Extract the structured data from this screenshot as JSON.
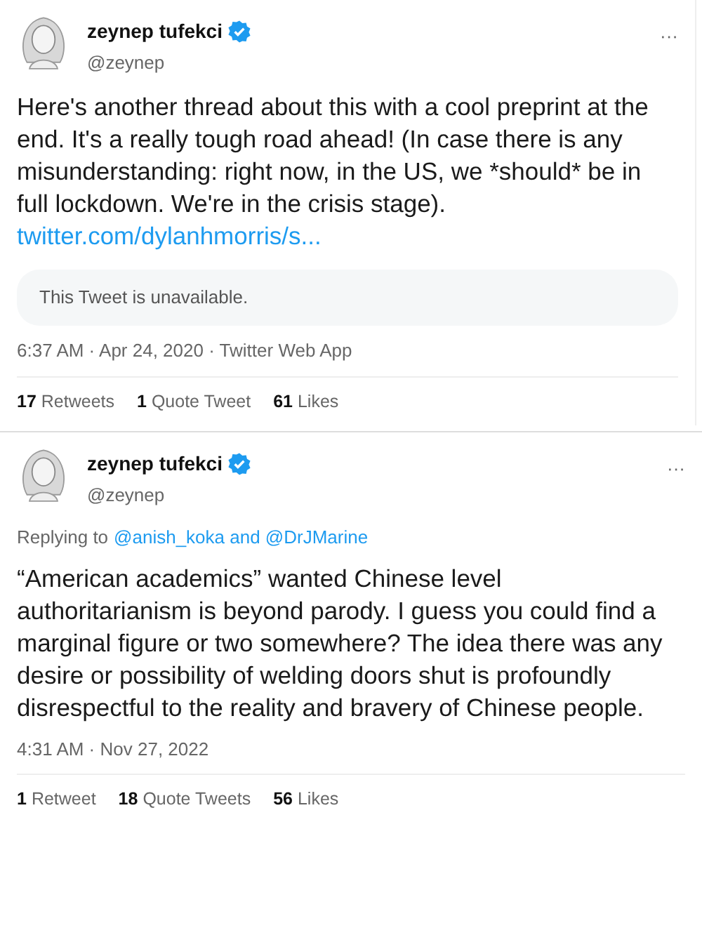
{
  "tweets": [
    {
      "author": {
        "name": "zeynep tufekci",
        "verified": true,
        "handle": "@zeynep"
      },
      "more": "···",
      "text": "Here's another thread about this with a cool preprint at the end. It's a really tough road ahead! (In case there is any misunderstanding: right now, in the US, we *should* be in full lockdown. We're in the crisis stage).",
      "link": "twitter.com/dylanhmorris/s...",
      "quote": "This Tweet is unavailable.",
      "meta": "6:37 AM · Apr 24, 2020 · Twitter Web App",
      "stats": [
        {
          "count": "17",
          "label": "Retweets"
        },
        {
          "count": "1",
          "label": "Quote Tweet"
        },
        {
          "count": "61",
          "label": "Likes"
        }
      ]
    },
    {
      "author": {
        "name": "zeynep tufekci",
        "verified": true,
        "handle": "@zeynep"
      },
      "more": "···",
      "replying_to": {
        "prefix": "Replying to",
        "mentions": "@anish_koka and @DrJMarine"
      },
      "text": "“American academics” wanted Chinese level authoritarianism is beyond parody. I guess you could find a marginal figure or two somewhere? The idea there was any desire or possibility of welding doors shut is profoundly disrespectful to the reality and bravery of Chinese people.",
      "meta": "4:31 AM · Nov 27, 2022",
      "stats": [
        {
          "count": "1",
          "label": "Retweet"
        },
        {
          "count": "18",
          "label": "Quote Tweets"
        },
        {
          "count": "56",
          "label": "Likes"
        }
      ]
    }
  ]
}
